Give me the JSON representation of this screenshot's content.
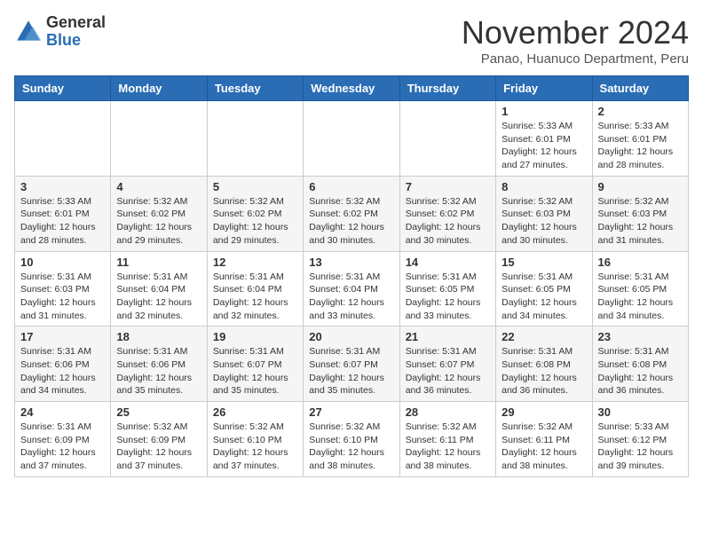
{
  "header": {
    "logo_general": "General",
    "logo_blue": "Blue",
    "month_title": "November 2024",
    "subtitle": "Panao, Huanuco Department, Peru"
  },
  "weekdays": [
    "Sunday",
    "Monday",
    "Tuesday",
    "Wednesday",
    "Thursday",
    "Friday",
    "Saturday"
  ],
  "weeks": [
    [
      {
        "day": "",
        "info": ""
      },
      {
        "day": "",
        "info": ""
      },
      {
        "day": "",
        "info": ""
      },
      {
        "day": "",
        "info": ""
      },
      {
        "day": "",
        "info": ""
      },
      {
        "day": "1",
        "info": "Sunrise: 5:33 AM\nSunset: 6:01 PM\nDaylight: 12 hours\nand 27 minutes."
      },
      {
        "day": "2",
        "info": "Sunrise: 5:33 AM\nSunset: 6:01 PM\nDaylight: 12 hours\nand 28 minutes."
      }
    ],
    [
      {
        "day": "3",
        "info": "Sunrise: 5:33 AM\nSunset: 6:01 PM\nDaylight: 12 hours\nand 28 minutes."
      },
      {
        "day": "4",
        "info": "Sunrise: 5:32 AM\nSunset: 6:02 PM\nDaylight: 12 hours\nand 29 minutes."
      },
      {
        "day": "5",
        "info": "Sunrise: 5:32 AM\nSunset: 6:02 PM\nDaylight: 12 hours\nand 29 minutes."
      },
      {
        "day": "6",
        "info": "Sunrise: 5:32 AM\nSunset: 6:02 PM\nDaylight: 12 hours\nand 30 minutes."
      },
      {
        "day": "7",
        "info": "Sunrise: 5:32 AM\nSunset: 6:02 PM\nDaylight: 12 hours\nand 30 minutes."
      },
      {
        "day": "8",
        "info": "Sunrise: 5:32 AM\nSunset: 6:03 PM\nDaylight: 12 hours\nand 30 minutes."
      },
      {
        "day": "9",
        "info": "Sunrise: 5:32 AM\nSunset: 6:03 PM\nDaylight: 12 hours\nand 31 minutes."
      }
    ],
    [
      {
        "day": "10",
        "info": "Sunrise: 5:31 AM\nSunset: 6:03 PM\nDaylight: 12 hours\nand 31 minutes."
      },
      {
        "day": "11",
        "info": "Sunrise: 5:31 AM\nSunset: 6:04 PM\nDaylight: 12 hours\nand 32 minutes."
      },
      {
        "day": "12",
        "info": "Sunrise: 5:31 AM\nSunset: 6:04 PM\nDaylight: 12 hours\nand 32 minutes."
      },
      {
        "day": "13",
        "info": "Sunrise: 5:31 AM\nSunset: 6:04 PM\nDaylight: 12 hours\nand 33 minutes."
      },
      {
        "day": "14",
        "info": "Sunrise: 5:31 AM\nSunset: 6:05 PM\nDaylight: 12 hours\nand 33 minutes."
      },
      {
        "day": "15",
        "info": "Sunrise: 5:31 AM\nSunset: 6:05 PM\nDaylight: 12 hours\nand 34 minutes."
      },
      {
        "day": "16",
        "info": "Sunrise: 5:31 AM\nSunset: 6:05 PM\nDaylight: 12 hours\nand 34 minutes."
      }
    ],
    [
      {
        "day": "17",
        "info": "Sunrise: 5:31 AM\nSunset: 6:06 PM\nDaylight: 12 hours\nand 34 minutes."
      },
      {
        "day": "18",
        "info": "Sunrise: 5:31 AM\nSunset: 6:06 PM\nDaylight: 12 hours\nand 35 minutes."
      },
      {
        "day": "19",
        "info": "Sunrise: 5:31 AM\nSunset: 6:07 PM\nDaylight: 12 hours\nand 35 minutes."
      },
      {
        "day": "20",
        "info": "Sunrise: 5:31 AM\nSunset: 6:07 PM\nDaylight: 12 hours\nand 35 minutes."
      },
      {
        "day": "21",
        "info": "Sunrise: 5:31 AM\nSunset: 6:07 PM\nDaylight: 12 hours\nand 36 minutes."
      },
      {
        "day": "22",
        "info": "Sunrise: 5:31 AM\nSunset: 6:08 PM\nDaylight: 12 hours\nand 36 minutes."
      },
      {
        "day": "23",
        "info": "Sunrise: 5:31 AM\nSunset: 6:08 PM\nDaylight: 12 hours\nand 36 minutes."
      }
    ],
    [
      {
        "day": "24",
        "info": "Sunrise: 5:31 AM\nSunset: 6:09 PM\nDaylight: 12 hours\nand 37 minutes."
      },
      {
        "day": "25",
        "info": "Sunrise: 5:32 AM\nSunset: 6:09 PM\nDaylight: 12 hours\nand 37 minutes."
      },
      {
        "day": "26",
        "info": "Sunrise: 5:32 AM\nSunset: 6:10 PM\nDaylight: 12 hours\nand 37 minutes."
      },
      {
        "day": "27",
        "info": "Sunrise: 5:32 AM\nSunset: 6:10 PM\nDaylight: 12 hours\nand 38 minutes."
      },
      {
        "day": "28",
        "info": "Sunrise: 5:32 AM\nSunset: 6:11 PM\nDaylight: 12 hours\nand 38 minutes."
      },
      {
        "day": "29",
        "info": "Sunrise: 5:32 AM\nSunset: 6:11 PM\nDaylight: 12 hours\nand 38 minutes."
      },
      {
        "day": "30",
        "info": "Sunrise: 5:33 AM\nSunset: 6:12 PM\nDaylight: 12 hours\nand 39 minutes."
      }
    ]
  ]
}
